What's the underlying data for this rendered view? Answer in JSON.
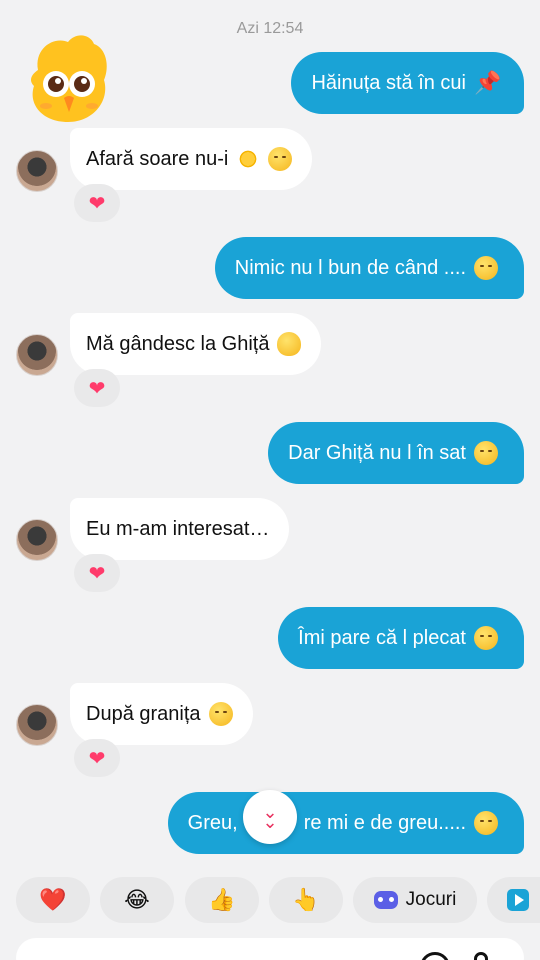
{
  "header": {
    "timestamp": "Azi 12:54"
  },
  "messages": [
    {
      "dir": "out",
      "text": "Hăinuța stă în cui",
      "emoji": "pushpin-icon"
    },
    {
      "dir": "in",
      "text": "Afară soare nu-i",
      "emoji": "sun-icon",
      "emoji2": "relieved-face-icon",
      "reaction": "❤"
    },
    {
      "dir": "out",
      "text": "Nimic nu l bun de când ....",
      "emoji": "tired-face-icon"
    },
    {
      "dir": "in",
      "text": "Mă gândesc la Ghiță",
      "emoji": "hugging-face-icon",
      "reaction": "❤"
    },
    {
      "dir": "out",
      "text": "Dar Ghiță nu l în sat",
      "emoji": "unamused-face-icon"
    },
    {
      "dir": "in",
      "text": "Eu m-am interesat…",
      "reaction": "❤"
    },
    {
      "dir": "out",
      "text": "Îmi pare că l plecat",
      "emoji": "pleading-face-icon"
    },
    {
      "dir": "in",
      "text": "După granița",
      "emoji": "disappointed-face-icon",
      "reaction": "❤"
    },
    {
      "dir": "out",
      "text_left": "Greu,",
      "text_right": "re mi e de greu.....",
      "emoji": "pensive-face-icon"
    }
  ],
  "scroll_button": {
    "glyph": "⌄"
  },
  "quick_replies": [
    {
      "glyph": "❤️",
      "name": "heart"
    },
    {
      "glyph": "😂",
      "name": "laughing"
    },
    {
      "glyph": "👍",
      "name": "thumbs-up"
    },
    {
      "glyph": "👆",
      "name": "pointing-up"
    },
    {
      "label": "Jocuri",
      "icon": "gamepad-icon"
    },
    {
      "icon": "play-icon"
    }
  ],
  "colors": {
    "outgoing_bubble": "#1aa3d6",
    "incoming_bubble": "#ffffff",
    "background": "#f2f2f3",
    "reaction_heart": "#ff3b6b"
  }
}
